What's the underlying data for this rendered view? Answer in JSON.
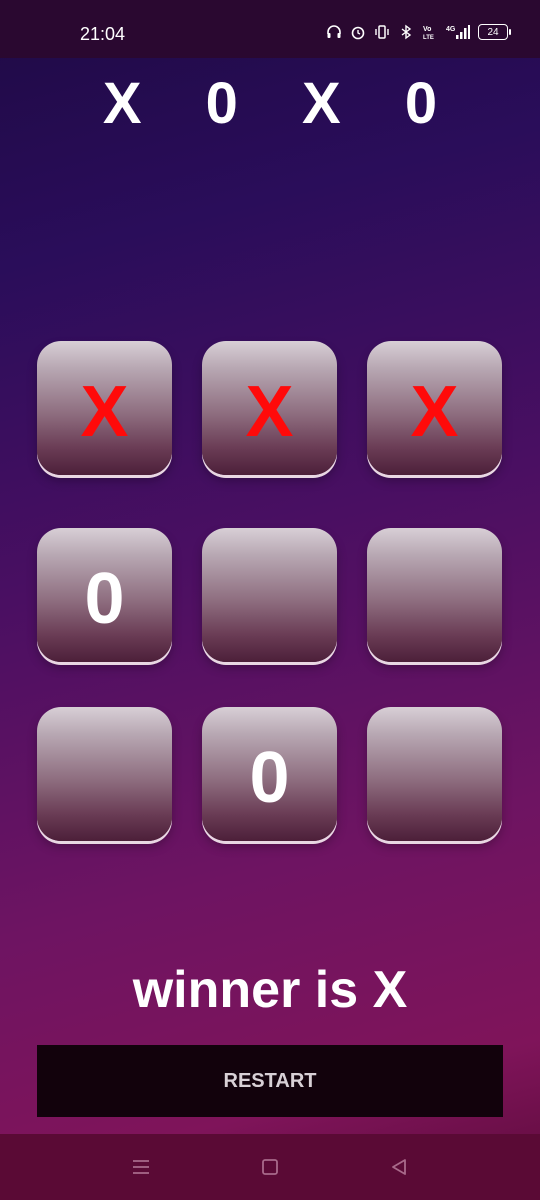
{
  "status_bar": {
    "time": "21:04",
    "battery": "24",
    "icons": [
      "headphones-icon",
      "alarm-icon",
      "vibrate-icon",
      "bluetooth-icon",
      "volte-icon",
      "4g-signal-icon",
      "battery-icon"
    ]
  },
  "game": {
    "title": "X 0 X 0",
    "board": [
      [
        "X",
        "X",
        "X"
      ],
      [
        "0",
        "",
        ""
      ],
      [
        "",
        "0",
        ""
      ]
    ],
    "winner_text": "winner is X",
    "restart_label": "RESTART"
  },
  "colors": {
    "x_mark": "#ff0a0a",
    "o_mark": "#ffffff",
    "restart_bg": "#12020c",
    "nav_bar": "#5a0a35"
  },
  "nav_bar": {
    "icons": [
      "menu-icon",
      "home-square-icon",
      "back-triangle-icon"
    ]
  }
}
